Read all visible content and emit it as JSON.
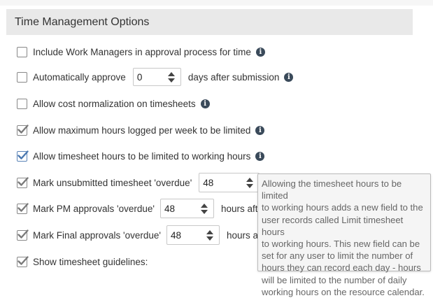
{
  "header": {
    "title": "Time Management Options"
  },
  "options": {
    "work_managers": {
      "label": "Include Work Managers in approval process for time",
      "checked": false
    },
    "auto_approve": {
      "label": "Automatically approve",
      "value": "0",
      "suffix": "days after submission",
      "checked": false
    },
    "cost_normalization": {
      "label": "Allow cost normalization on timesheets",
      "checked": false
    },
    "max_hours": {
      "label": "Allow maximum hours logged per week to be limited",
      "checked": true
    },
    "limit_working_hours": {
      "label": "Allow timesheet hours to be limited to working hours",
      "checked": true
    },
    "unsubmitted_overdue": {
      "label": "Mark unsubmitted timesheet 'overdue'",
      "value": "48",
      "suffix": "h",
      "checked": true
    },
    "pm_overdue": {
      "label": "Mark PM approvals 'overdue'",
      "value": "48",
      "suffix": "hours after t",
      "checked": true
    },
    "final_overdue": {
      "label": "Mark Final approvals 'overdue'",
      "value": "48",
      "suffix": "hours afte",
      "checked": true
    },
    "guidelines": {
      "label": "Show timesheet guidelines:",
      "checked": true
    }
  },
  "tooltip": {
    "lines": [
      "Allowing the timesheet hours to be limited",
      "to working hours adds a new field to the",
      "user records called Limit timesheet hours",
      "to working hours. This new field can be",
      "set for any user to limit the number of",
      "hours they can record each day - hours",
      "will be limited to the number of daily",
      "working hours on the resource calendar."
    ]
  },
  "icons": {
    "info": "info-circle-icon",
    "checkbox": "checkmark-icon",
    "spinner": "up-down-arrows-icon"
  },
  "colors": {
    "header_bg": "#e9e9e9",
    "check_gray": "#7a7a7a",
    "check_blue": "#4a78b0",
    "info_icon": "#3a4a5a",
    "tooltip_bg": "#f5f5f5"
  }
}
